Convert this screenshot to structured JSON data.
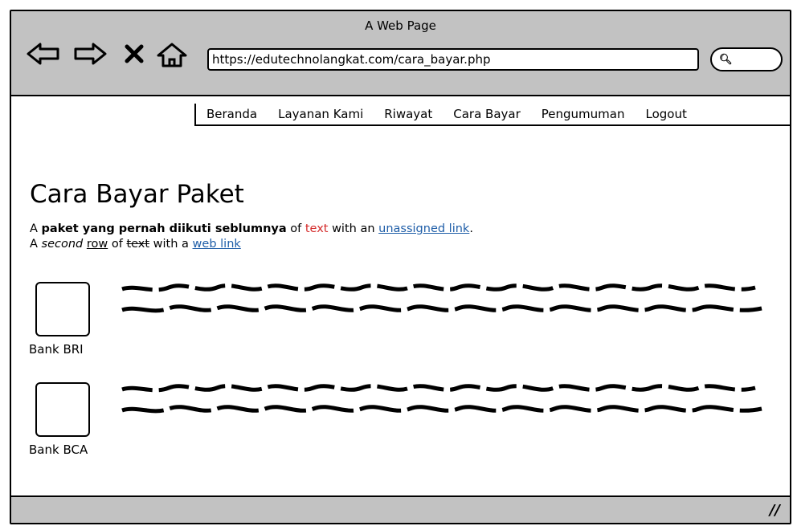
{
  "window": {
    "title": "A Web Page"
  },
  "browser": {
    "url": "https://edutechnolangkat.com/cara_bayar.php",
    "buttons": [
      "back-icon",
      "forward-icon",
      "stop-icon",
      "home-icon"
    ]
  },
  "menu": {
    "items": [
      "Beranda",
      "Layanan Kami",
      "Riwayat",
      "Cara Bayar",
      "Pengumuman",
      "Logout"
    ]
  },
  "main": {
    "title": "Cara Bayar Paket",
    "line1": {
      "prefix": "A ",
      "bold": "paket yang pernah diikuti seblumnya",
      "mid": " of ",
      "red": "text",
      "mid2": " with an ",
      "link": "unassigned link",
      "suffix": "."
    },
    "line2": {
      "prefix": "A ",
      "italic": "second",
      "space": " ",
      "underlined": "row",
      "mid": " of ",
      "strike": "text",
      "mid2": " with a ",
      "link": "web link"
    },
    "banks": [
      {
        "label": "Bank BRI"
      },
      {
        "label": "Bank BCA"
      }
    ]
  },
  "colors": {
    "chrome": "#c2c2c2",
    "link": "#1f5ea8",
    "red": "#d42a2a"
  }
}
